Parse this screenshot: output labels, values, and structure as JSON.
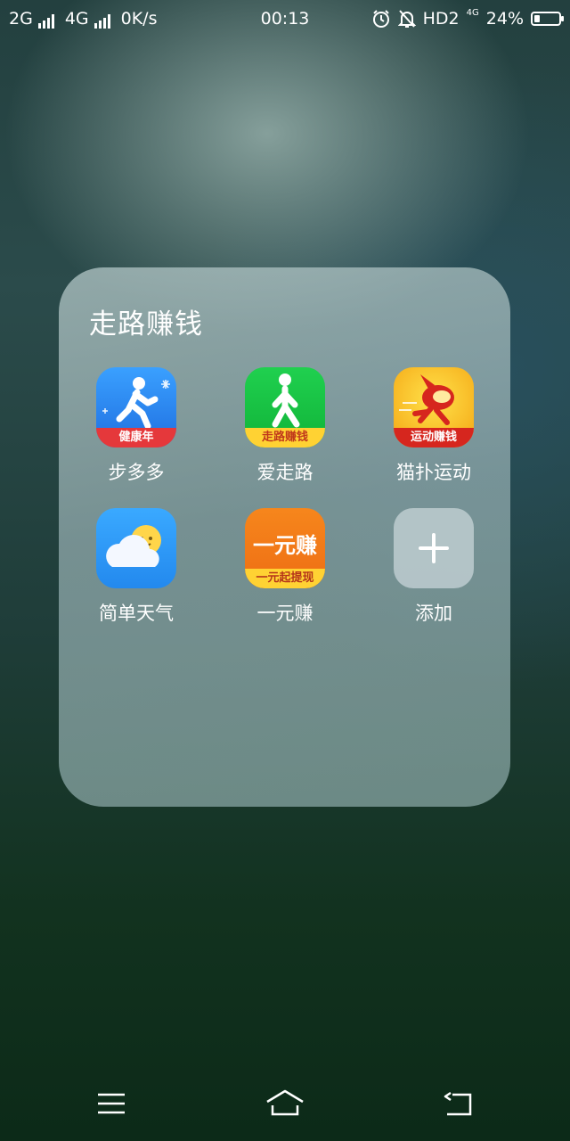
{
  "status_bar": {
    "network1": "2G",
    "network2": "4G",
    "speed": "0K/s",
    "time": "00:13",
    "hd": "HD2",
    "small_network": "4G",
    "battery_percent": "24%",
    "battery_level": 0.24,
    "alarm_icon": "alarm-clock-icon",
    "mute_icon": "bell-off-icon"
  },
  "folder": {
    "title": "走路赚钱",
    "apps": [
      {
        "name": "步多多",
        "icon": "running-person-icon",
        "ribbon": "健康年",
        "color": "#2f8ff0"
      },
      {
        "name": "爱走路",
        "icon": "walking-person-icon",
        "ribbon": "走路赚钱",
        "color": "#19c445"
      },
      {
        "name": "猫扑运动",
        "icon": "mascot-icon",
        "ribbon": "运动赚钱",
        "color": "#f3b51c"
      },
      {
        "name": "简单天气",
        "icon": "weather-sun-cloud-icon",
        "color": "#2c9cf2"
      },
      {
        "name": "一元赚",
        "icon": "coin-icon",
        "top_text": "一元赚",
        "ribbon": "一元起提现",
        "color": "#f27a1a"
      },
      {
        "name": "添加",
        "icon": "plus-icon",
        "color": "#a8b8bc"
      }
    ]
  },
  "nav_bar": {
    "menu_icon": "menu-icon",
    "home_icon": "home-icon",
    "back_icon": "back-icon"
  }
}
